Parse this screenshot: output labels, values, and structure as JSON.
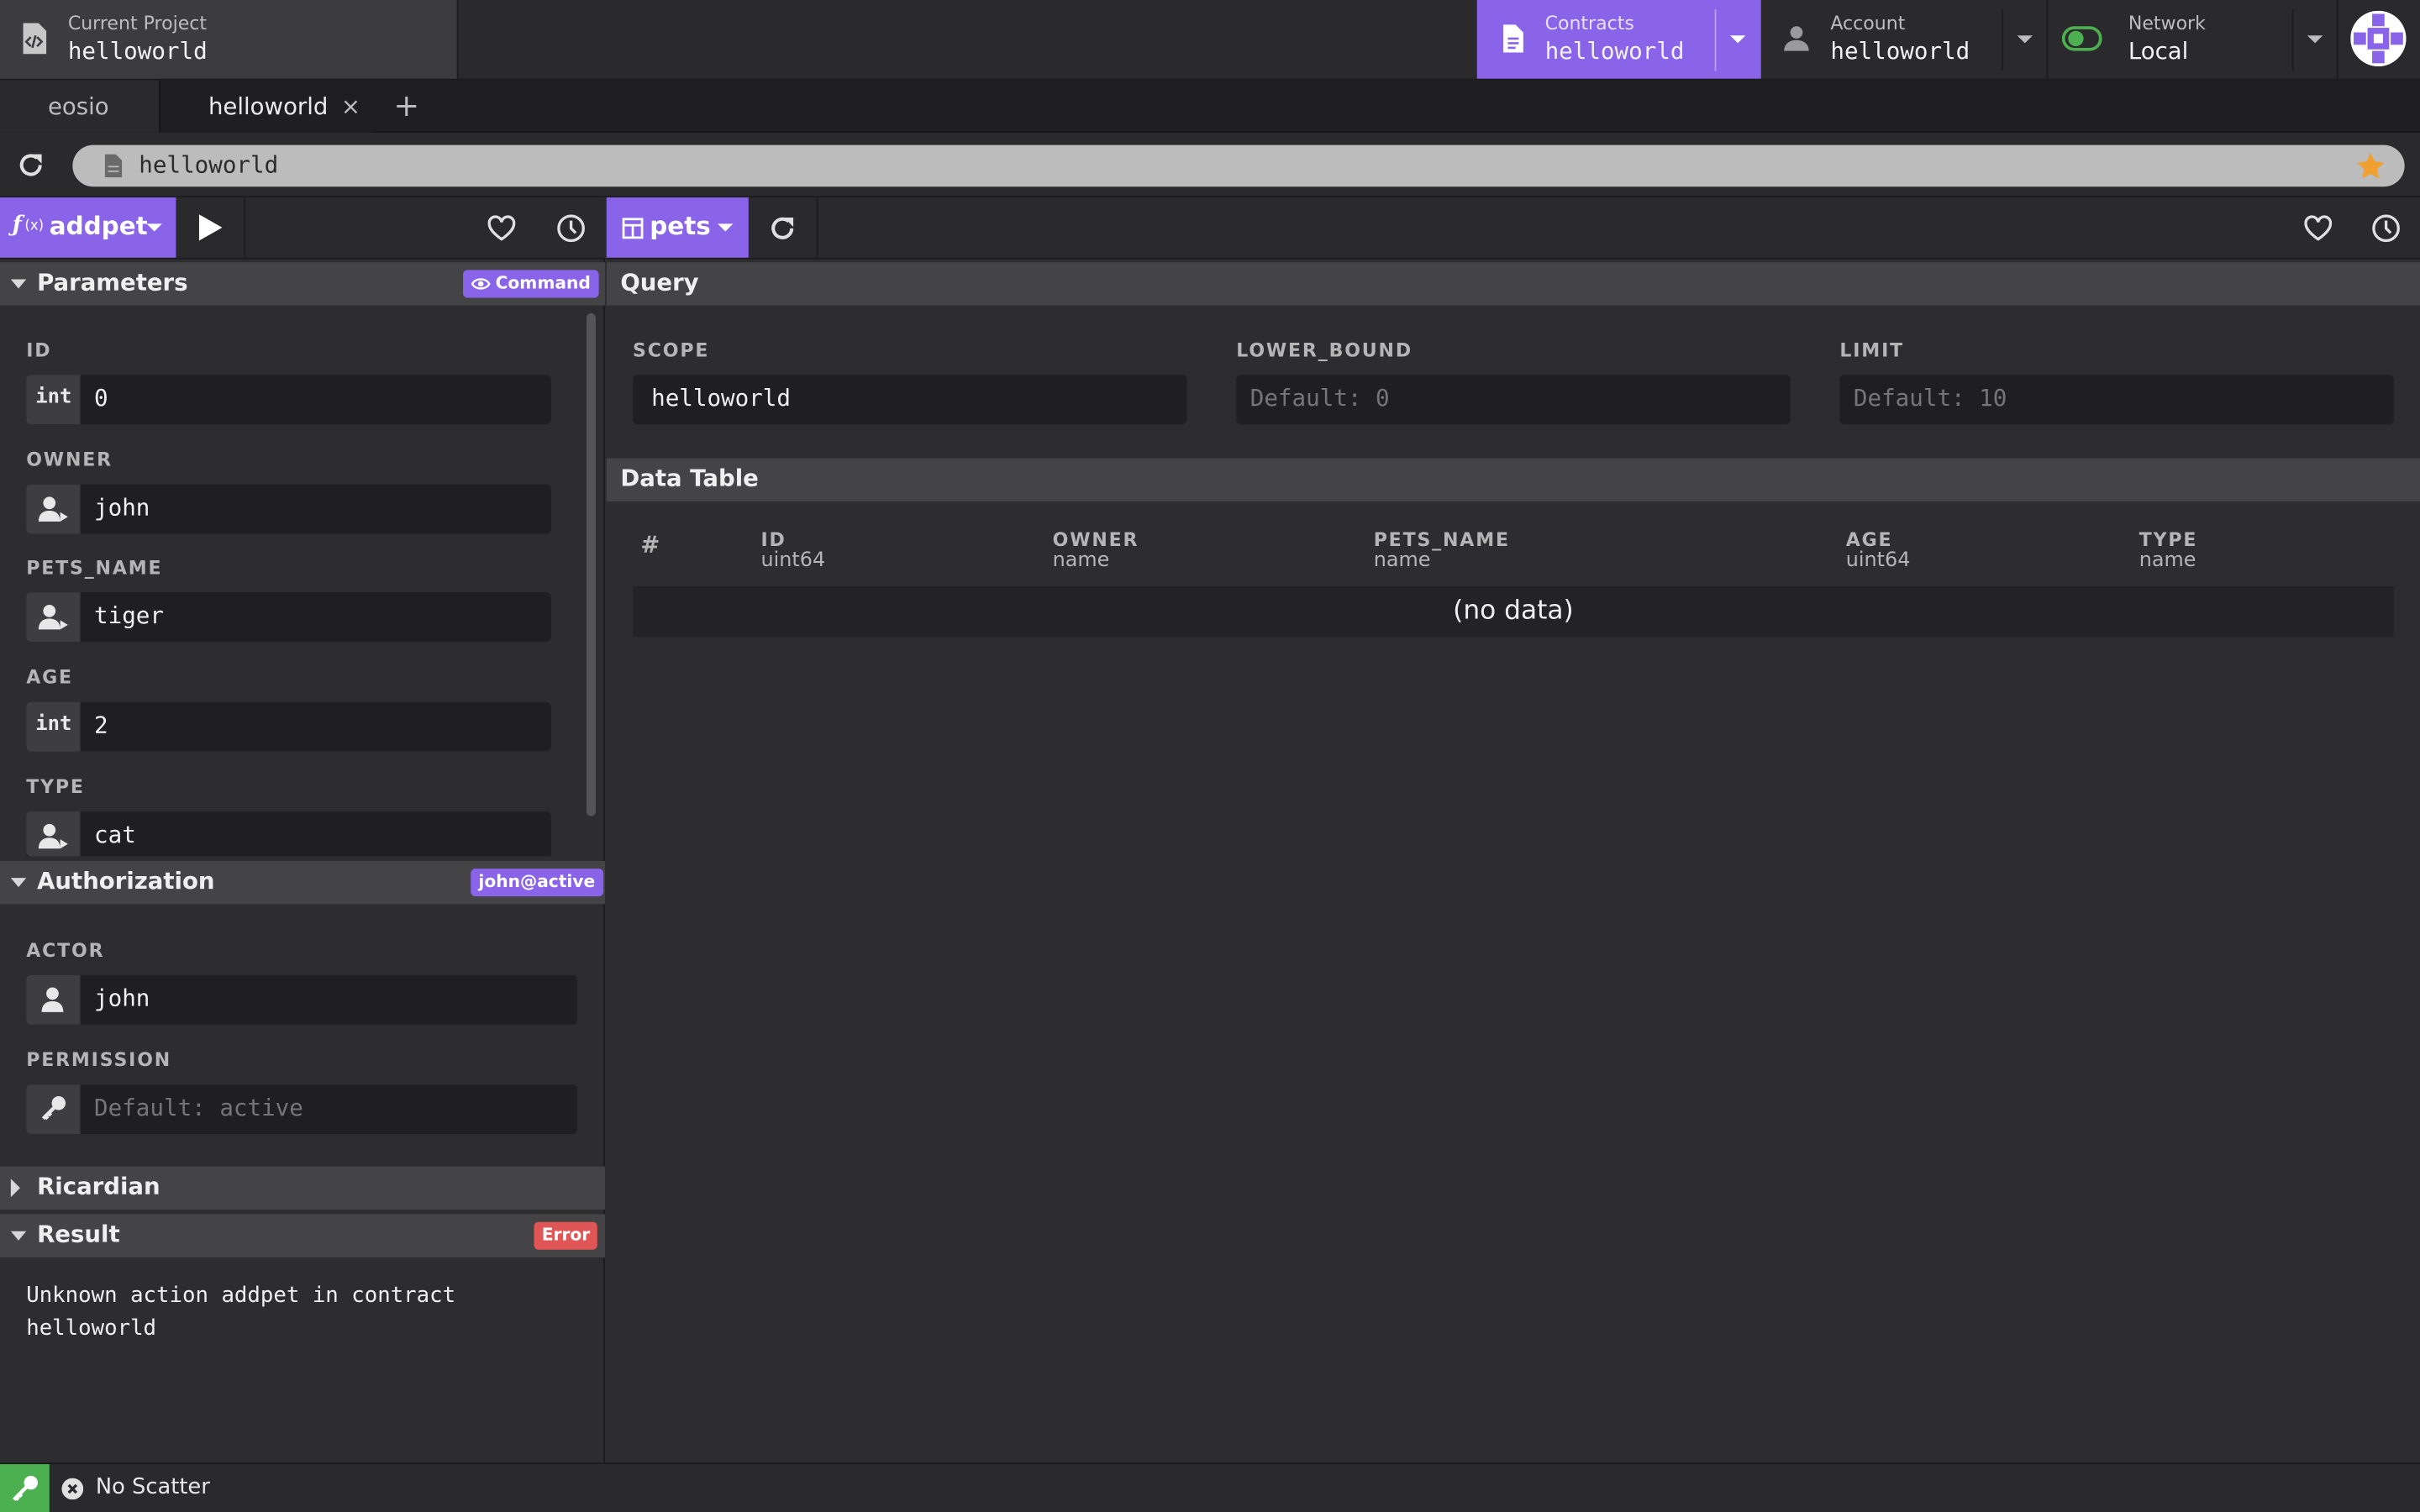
{
  "header": {
    "project": {
      "label": "Current Project",
      "value": "helloworld"
    },
    "contracts": {
      "label": "Contracts",
      "value": "helloworld"
    },
    "account": {
      "label": "Account",
      "value": "helloworld"
    },
    "network": {
      "label": "Network",
      "value": "Local"
    }
  },
  "tabs": [
    {
      "label": "eosio"
    },
    {
      "label": "helloworld",
      "close": "×"
    }
  ],
  "tab_add": "+",
  "address": {
    "value": "helloworld"
  },
  "action_panel": {
    "action": "addpet",
    "parameters": {
      "title": "Parameters",
      "badge": "Command",
      "fields": [
        {
          "label": "ID",
          "icon": "int",
          "value": "0"
        },
        {
          "label": "OWNER",
          "icon": "account-icon",
          "value": "john"
        },
        {
          "label": "PETS_NAME",
          "icon": "account-icon",
          "value": "tiger"
        },
        {
          "label": "AGE",
          "icon": "int",
          "value": "2"
        },
        {
          "label": "TYPE",
          "icon": "account-icon",
          "value": "cat"
        }
      ]
    },
    "authorization": {
      "title": "Authorization",
      "badge": "john@active",
      "actor_label": "ACTOR",
      "actor_value": "john",
      "permission_label": "PERMISSION",
      "permission_placeholder": "Default: active"
    },
    "ricardian": {
      "title": "Ricardian"
    },
    "result": {
      "title": "Result",
      "badge": "Error",
      "message_line1": "Unknown action addpet in contract",
      "message_line2": "helloworld"
    }
  },
  "table_panel": {
    "table": "pets",
    "query": {
      "title": "Query",
      "scope_label": "SCOPE",
      "scope_value": "helloworld",
      "lower_bound_label": "LOWER_BOUND",
      "lower_bound_placeholder": "Default: 0",
      "limit_label": "LIMIT",
      "limit_placeholder": "Default: 10"
    },
    "data_table": {
      "title": "Data Table",
      "hash": "#",
      "columns": [
        {
          "name": "ID",
          "type": "uint64"
        },
        {
          "name": "OWNER",
          "type": "name"
        },
        {
          "name": "PETS_NAME",
          "type": "name"
        },
        {
          "name": "AGE",
          "type": "uint64"
        },
        {
          "name": "TYPE",
          "type": "name"
        }
      ],
      "empty_text": "(no data)"
    }
  },
  "status_bar": {
    "text": "No Scatter"
  },
  "colors": {
    "accent": "#8963e8",
    "error": "#e05555",
    "success": "#4caf50",
    "star": "#f0a030"
  }
}
